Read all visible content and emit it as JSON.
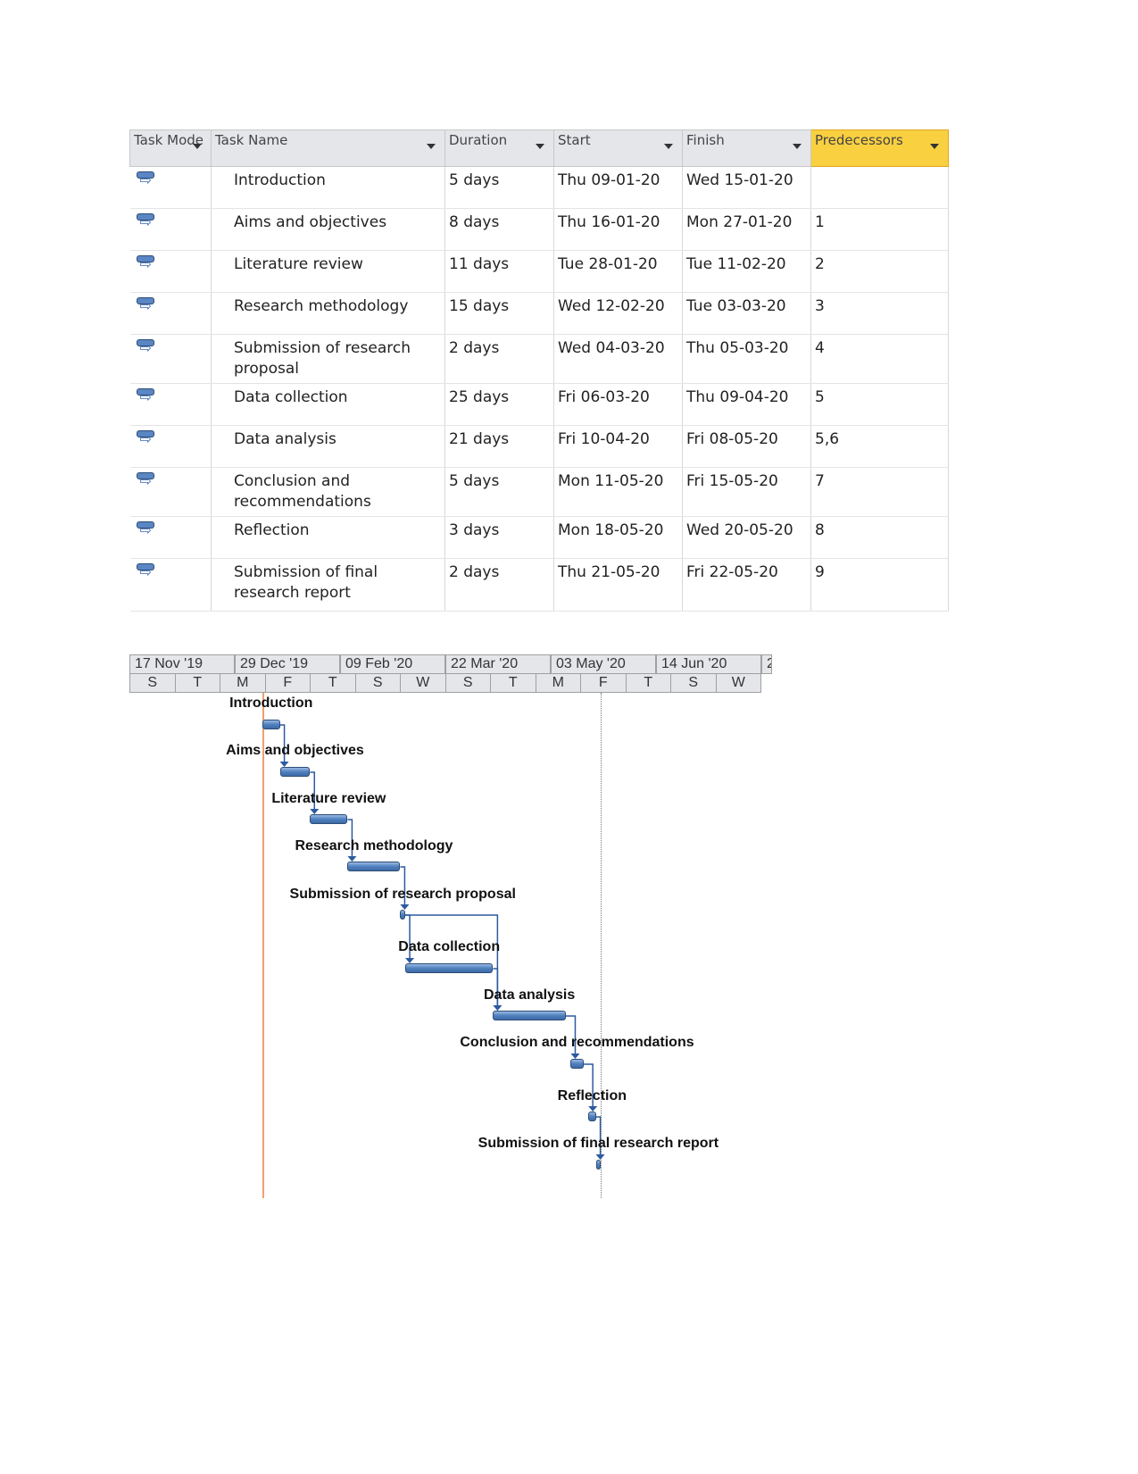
{
  "table": {
    "headers": [
      "Task Mode",
      "Task Name",
      "Duration",
      "Start",
      "Finish",
      "Predecessors"
    ],
    "rows": [
      {
        "name": "Introduction",
        "duration": "5 days",
        "start": "Thu 09-01-20",
        "finish": "Wed 15-01-20",
        "pred": ""
      },
      {
        "name": "Aims and objectives",
        "duration": "8 days",
        "start": "Thu 16-01-20",
        "finish": "Mon 27-01-20",
        "pred": "1"
      },
      {
        "name": "Literature review",
        "duration": "11 days",
        "start": "Tue 28-01-20",
        "finish": "Tue 11-02-20",
        "pred": "2"
      },
      {
        "name": "Research methodology",
        "duration": "15 days",
        "start": "Wed 12-02-20",
        "finish": "Tue 03-03-20",
        "pred": "3"
      },
      {
        "name": "Submission of research proposal",
        "duration": "2 days",
        "start": "Wed 04-03-20",
        "finish": "Thu 05-03-20",
        "pred": "4"
      },
      {
        "name": "Data collection",
        "duration": "25 days",
        "start": "Fri 06-03-20",
        "finish": "Thu 09-04-20",
        "pred": "5"
      },
      {
        "name": "Data analysis",
        "duration": "21 days",
        "start": "Fri 10-04-20",
        "finish": "Fri 08-05-20",
        "pred": "5,6"
      },
      {
        "name": "Conclusion and recommendations",
        "duration": "5 days",
        "start": "Mon 11-05-20",
        "finish": "Fri 15-05-20",
        "pred": "7"
      },
      {
        "name": "Reflection",
        "duration": "3 days",
        "start": "Mon 18-05-20",
        "finish": "Wed 20-05-20",
        "pred": "8"
      },
      {
        "name": "Submission of final research report",
        "duration": "2 days",
        "start": "Thu 21-05-20",
        "finish": "Fri 22-05-20",
        "pred": "9"
      }
    ]
  },
  "gantt": {
    "major_ticks": [
      "17 Nov '19",
      "29 Dec '19",
      "09 Feb '20",
      "22 Mar '20",
      "03 May '20",
      "14 Jun '20",
      "2"
    ],
    "minor_ticks": [
      "S",
      "T",
      "M",
      "F",
      "T",
      "S",
      "W",
      "S",
      "T",
      "M",
      "F",
      "T",
      "S",
      "W"
    ],
    "labels": [
      "Introduction",
      "Aims and objectives",
      "Literature review",
      "Research methodology",
      "Submission of research proposal",
      "Data collection",
      "Data analysis",
      "Conclusion and recommendations",
      "Reflection",
      "Submission of final research report"
    ],
    "bar_color": "#4f81bd",
    "project_start_line_color": "#f0a070",
    "status_line": "dotted"
  }
}
